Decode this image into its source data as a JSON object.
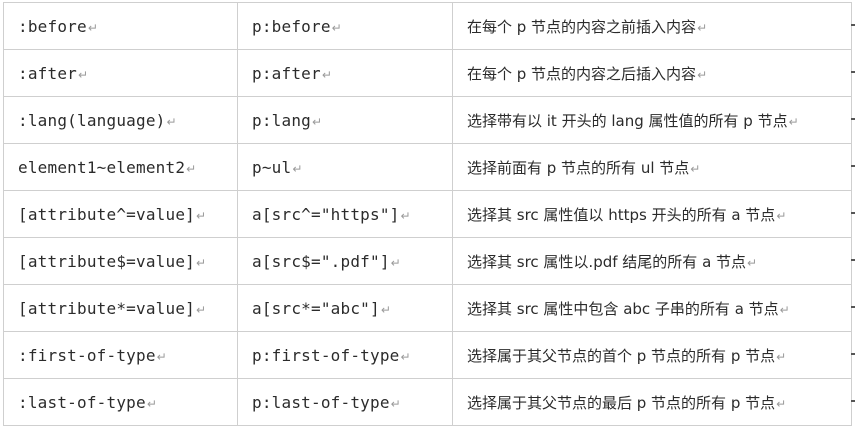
{
  "table": {
    "rows": [
      {
        "selector": ":before",
        "example": "p:before",
        "description": "在每个 p 节点的内容之前插入内容"
      },
      {
        "selector": ":after",
        "example": "p:after",
        "description": "在每个 p 节点的内容之后插入内容"
      },
      {
        "selector": ":lang(language)",
        "example": "p:lang",
        "description": "选择带有以 it 开头的 lang 属性值的所有 p 节点"
      },
      {
        "selector": "element1~element2",
        "example": "p~ul",
        "description": "选择前面有 p 节点的所有 ul 节点"
      },
      {
        "selector": "[attribute^=value]",
        "example": "a[src^=\"https\"]",
        "description": "选择其 src 属性值以 https 开头的所有 a 节点"
      },
      {
        "selector": "[attribute$=value]",
        "example": "a[src$=\".pdf\"]",
        "description": "选择其 src 属性以.pdf 结尾的所有 a 节点"
      },
      {
        "selector": "[attribute*=value]",
        "example": "a[src*=\"abc\"]",
        "description": "选择其 src 属性中包含 abc 子串的所有 a 节点"
      },
      {
        "selector": ":first-of-type",
        "example": "p:first-of-type",
        "description": "选择属于其父节点的首个 p 节点的所有 p 节点"
      },
      {
        "selector": ":last-of-type",
        "example": "p:last-of-type",
        "description": "选择属于其父节点的最后 p 节点的所有 p 节点"
      }
    ],
    "paragraph_mark": "↵",
    "border_color": "#cfcfcf",
    "text_color": "#2b2b2b"
  }
}
